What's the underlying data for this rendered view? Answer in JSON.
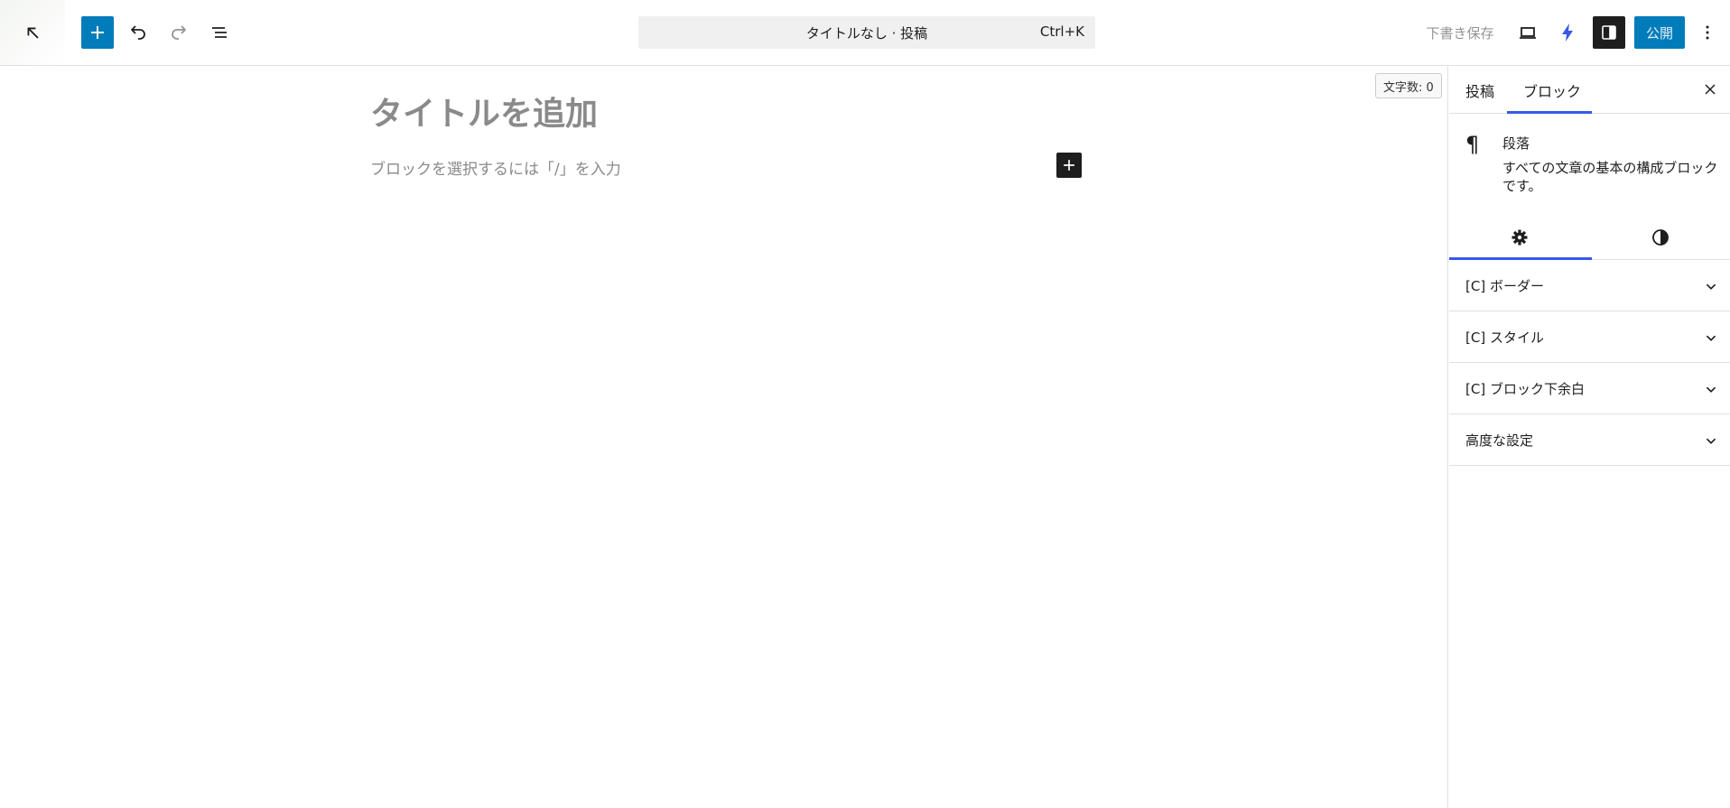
{
  "toolbar": {
    "document_title": "タイトルなし · 投稿",
    "command_shortcut": "Ctrl+K",
    "save_draft": "下書き保存",
    "publish": "公開"
  },
  "editor": {
    "word_count": "文字数: 0",
    "title_placeholder": "タイトルを追加",
    "block_placeholder": "ブロックを選択するには「/」を入力"
  },
  "sidebar": {
    "tabs": [
      {
        "label": "投稿"
      },
      {
        "label": "ブロック"
      }
    ],
    "active_tab": "ブロック",
    "block_card": {
      "title": "段落",
      "description": "すべての文章の基本の構成ブロックです。"
    },
    "panels": [
      {
        "label": "[C] ボーダー"
      },
      {
        "label": "[C] スタイル"
      },
      {
        "label": "[C] ブロック下余白"
      },
      {
        "label": "高度な設定"
      }
    ]
  },
  "colors": {
    "accent": "#007cba",
    "tab_indicator": "#3858e9",
    "dark": "#1e1e1e",
    "jetpack": "#3858e9"
  },
  "icons": {
    "back": "arrow-up-left-icon",
    "inserter": "plus-icon",
    "undo": "undo-icon",
    "redo": "redo-icon",
    "list_view": "list-view-icon",
    "preview": "desktop-icon",
    "jetpack": "bolt-icon",
    "settings": "sidebar-toggle-icon",
    "more": "vertical-ellipsis-icon",
    "close": "close-icon",
    "paragraph": "pilcrow-icon",
    "block_settings": "gear-icon",
    "block_styles": "contrast-icon",
    "panel_toggle": "chevron-down-icon"
  }
}
